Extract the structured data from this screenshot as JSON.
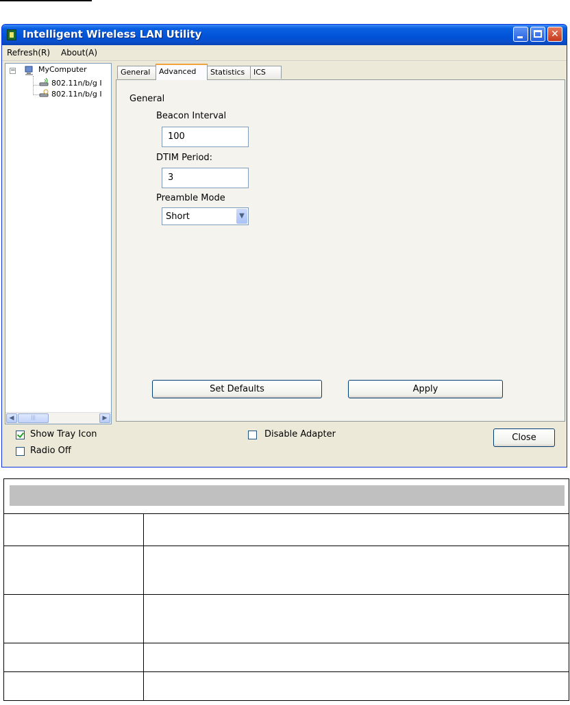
{
  "window": {
    "title": "Intelligent Wireless LAN Utility",
    "accent_color": "#0052d6"
  },
  "menu": {
    "refresh": "Refresh(R)",
    "about": "About(A)"
  },
  "tree": {
    "root": "MyComputer",
    "adapters": [
      "802.11n/b/g I",
      "802.11n/b/g I"
    ]
  },
  "tabs": {
    "general": "General",
    "advanced": "Advanced",
    "statistics": "Statistics",
    "ics": "ICS",
    "selected": "Advanced"
  },
  "advanced": {
    "section_label": "General",
    "beacon_label": "Beacon Interval",
    "beacon_value": "100",
    "dtim_label": "DTIM Period:",
    "dtim_value": "3",
    "preamble_label": "Preamble Mode",
    "preamble_value": "Short",
    "set_defaults": "Set Defaults",
    "apply": "Apply"
  },
  "bottom": {
    "show_tray_icon": "Show Tray Icon",
    "show_tray_checked": true,
    "radio_off": "Radio Off",
    "radio_off_checked": false,
    "disable_adapter": "Disable Adapter",
    "disable_adapter_checked": false,
    "close": "Close"
  }
}
